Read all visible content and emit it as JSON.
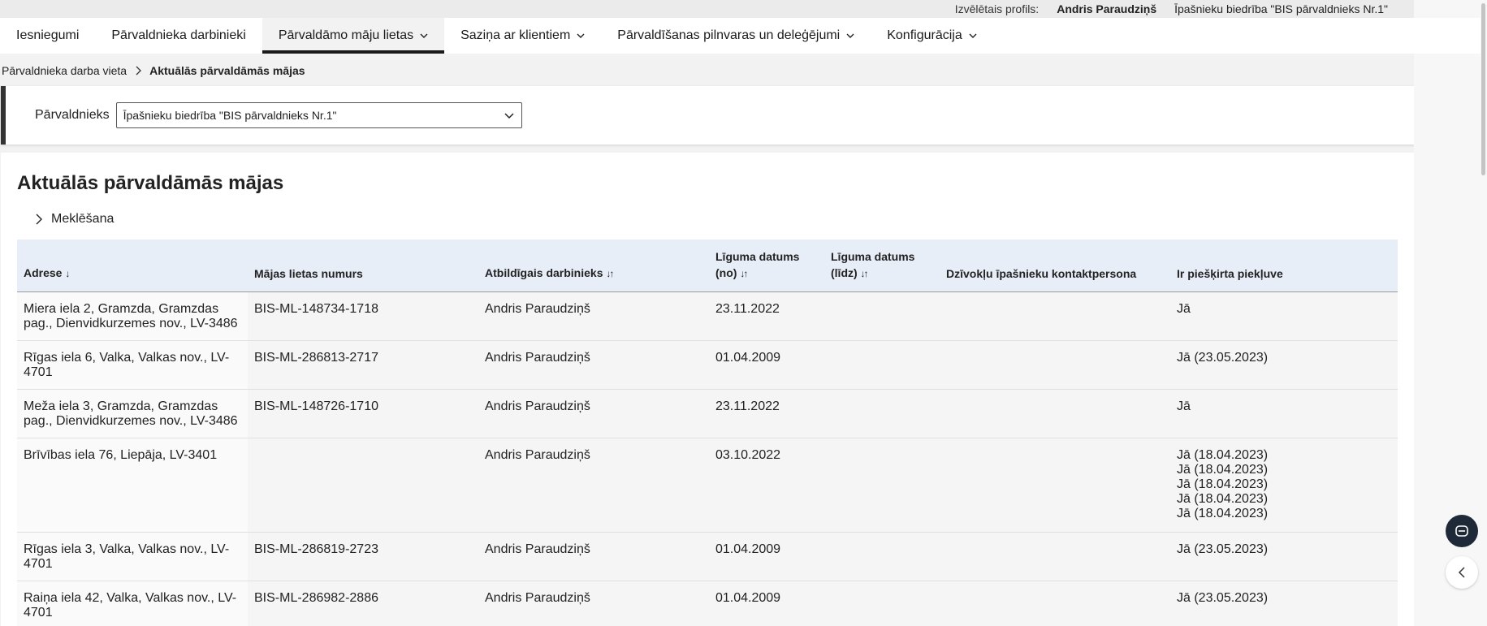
{
  "topbar": {
    "profile_label": "Izvēlētais profils:",
    "user_name": "Andris Paraudziņš",
    "organization": "Īpašnieku biedrība \"BIS pārvaldnieks Nr.1\""
  },
  "nav": {
    "items": [
      {
        "label": "Iesniegumi"
      },
      {
        "label": "Pārvaldnieka darbinieki"
      },
      {
        "label": "Pārvaldāmo māju lietas"
      },
      {
        "label": "Saziņa ar klientiem"
      },
      {
        "label": "Pārvaldīšanas pilnvaras un deleģējumi"
      },
      {
        "label": "Konfigurācija"
      }
    ]
  },
  "breadcrumb": {
    "parent": "Pārvaldnieka darba vieta",
    "current": "Aktuālās pārvaldāmās mājas"
  },
  "filter": {
    "label": "Pārvaldnieks",
    "selected": "Īpašnieku biedrība \"BIS pārvaldnieks Nr.1\""
  },
  "main": {
    "title": "Aktuālās pārvaldāmās mājas",
    "search_label": "Meklēšana"
  },
  "table": {
    "columns": [
      {
        "label": "Adrese",
        "sort": "↓"
      },
      {
        "label": "Mājas lietas numurs",
        "sort": ""
      },
      {
        "label": "Atbildīgais darbinieks",
        "sort": "↓↑"
      },
      {
        "label": "Līguma datums (no)",
        "sort": "↓↑"
      },
      {
        "label": "Līguma datums (līdz)",
        "sort": "↓↑"
      },
      {
        "label": "Dzīvokļu īpašnieku kontaktpersona",
        "sort": ""
      },
      {
        "label": "Ir piešķirta piekļuve",
        "sort": ""
      }
    ],
    "rows": [
      {
        "address": "Miera iela 2, Gramzda, Gramzdas pag., Dienvidkurzemes nov., LV-3486",
        "case_no": "BIS-ML-148734-1718",
        "employee": "Andris Paraudziņš",
        "date_from": "23.11.2022",
        "date_to": "",
        "contact": "",
        "access": "Jā"
      },
      {
        "address": "Rīgas iela 6, Valka, Valkas nov., LV-4701",
        "case_no": "BIS-ML-286813-2717",
        "employee": "Andris Paraudziņš",
        "date_from": "01.04.2009",
        "date_to": "",
        "contact": "",
        "access": "Jā (23.05.2023)"
      },
      {
        "address": "Meža iela 3, Gramzda, Gramzdas pag., Dienvidkurzemes nov., LV-3486",
        "case_no": "BIS-ML-148726-1710",
        "employee": "Andris Paraudziņš",
        "date_from": "23.11.2022",
        "date_to": "",
        "contact": "",
        "access": "Jā"
      },
      {
        "address": "Brīvības iela 76, Liepāja, LV-3401",
        "case_no": "",
        "employee": "Andris Paraudziņš",
        "date_from": "03.10.2022",
        "date_to": "",
        "contact": "",
        "access": "Jā (18.04.2023)\nJā (18.04.2023)\nJā (18.04.2023)\nJā (18.04.2023)\nJā (18.04.2023)"
      },
      {
        "address": "Rīgas iela 3, Valka, Valkas nov., LV-4701",
        "case_no": "BIS-ML-286819-2723",
        "employee": "Andris Paraudziņš",
        "date_from": "01.04.2009",
        "date_to": "",
        "contact": "",
        "access": "Jā (23.05.2023)"
      },
      {
        "address": "Raiņa iela 42, Valka, Valkas nov., LV-4701",
        "case_no": "BIS-ML-286982-2886",
        "employee": "Andris Paraudziņš",
        "date_from": "01.04.2009",
        "date_to": "",
        "contact": "",
        "access": "Jā (23.05.2023)"
      }
    ]
  },
  "icons": {
    "chat": "chat-bot-icon",
    "collapse": "chevron-left-icon"
  },
  "colors": {
    "header_bg": "#e8eef7",
    "nav_active_border": "#1a1a1a",
    "chat_button": "#1f2a38"
  }
}
